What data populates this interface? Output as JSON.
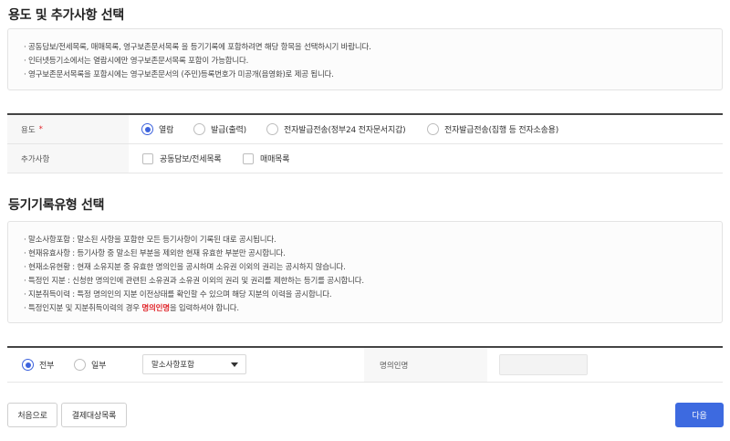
{
  "purpose_section": {
    "title": "용도 및 추가사항 선택",
    "notices": [
      "· 공동담보/전세목록, 매매목록, 영구보존문서목록 을 등기기록에 포함하려면 해당 항목을 선택하시기 바랍니다.",
      "· 인터넷등기소에서는 열람시에만 영구보존문서목록 포함이 가능합니다.",
      "· 영구보존문서목록을 포함시에는 영구보존문서의 (주민)등록번호가 미공개(음영화)로 제공 됩니다."
    ],
    "purpose_row": {
      "label": "용도",
      "required_mark": "*",
      "options": [
        {
          "label": "열람",
          "checked": true
        },
        {
          "label": "발급(출력)",
          "checked": false
        },
        {
          "label": "전자발급전송(정부24 전자문서지갑)",
          "checked": false
        },
        {
          "label": "전자발급전송(집행 등 전자소송용)",
          "checked": false
        }
      ]
    },
    "extra_row": {
      "label": "추가사항",
      "options": [
        {
          "label": "공동담보/전세목록",
          "checked": false
        },
        {
          "label": "매매목록",
          "checked": false
        }
      ]
    }
  },
  "record_type_section": {
    "title": "등기기록유형 선택",
    "notices": [
      "· 말소사항포함 : 말소된 사항을 포함한 모든 등기사항이 기록된 대로 공시됩니다.",
      "· 현재유효사항 : 등기사항 중 말소된 부분을 제외한 현재 유효한 부분만 공시합니다.",
      "· 현재소유현황 : 현재 소유지분 중 유효한 명의인을 공시하며 소유권 이외의 권리는 공시하지 않습니다.",
      "· 특정인 지분 : 신청한 명의인에 관련된 소유권과 소유권 이외의 권리 및 권리를 제한하는 등기를 공시합니다.",
      "· 지분취득이력 : 특정 명의인의 지분 이전상태를 확인할 수 있으며 해당 지분의 이력을 공시합니다."
    ],
    "last_notice": {
      "before": "· 특정인지분 및 지분취득이력의 경우 ",
      "highlight": "명의인명",
      "after": "을 입력하셔야 합니다."
    },
    "scope_options": [
      {
        "label": "전부",
        "checked": true
      },
      {
        "label": "일부",
        "checked": false
      }
    ],
    "type_select": {
      "value": "말소사항포함"
    },
    "owner_name": {
      "label": "명의인명",
      "value": ""
    }
  },
  "buttons": {
    "home": "처음으로",
    "payment_list": "결제대상목록",
    "next": "다음"
  },
  "colors": {
    "accent": "#3d63dd",
    "primary_button": "#3d6ae0",
    "highlight": "#e0262b"
  }
}
